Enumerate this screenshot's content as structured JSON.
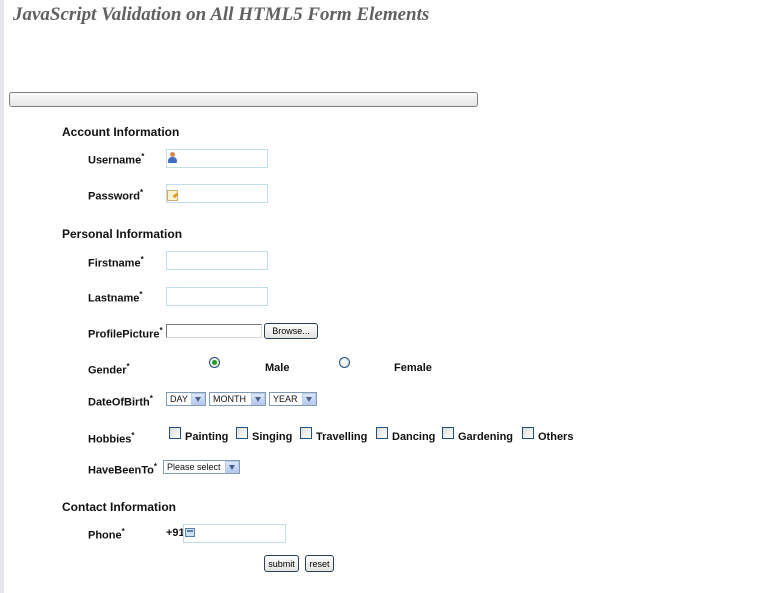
{
  "page": {
    "title": "JavaScript Validation on All HTML5 Form Elements"
  },
  "required_marker": "*",
  "account": {
    "heading": "Account Information",
    "username_label": "Username",
    "username_icon": "user-icon",
    "password_label": "Password",
    "password_icon": "key-icon"
  },
  "personal": {
    "heading": "Personal Information",
    "firstname_label": "Firstname",
    "lastname_label": "Lastname",
    "profile_picture_label": "ProfilePicture",
    "browse_label": "Browse...",
    "gender_label": "Gender",
    "gender_options": [
      {
        "label": "Male",
        "checked": true
      },
      {
        "label": "Female",
        "checked": false
      }
    ],
    "dob_label": "DateOfBirth",
    "dob_day": "DAY",
    "dob_month": "MONTH",
    "dob_year": "YEAR",
    "hobbies_label": "Hobbies",
    "hobbies": [
      {
        "label": "Painting",
        "checked": false
      },
      {
        "label": "Singing",
        "checked": false
      },
      {
        "label": "Travelling",
        "checked": false
      },
      {
        "label": "Dancing",
        "checked": false
      },
      {
        "label": "Gardening",
        "checked": false
      },
      {
        "label": "Others",
        "checked": false
      }
    ],
    "havebeento_label": "HaveBeenTo",
    "havebeento_selected": "Please select"
  },
  "contact": {
    "heading": "Contact Information",
    "phone_label": "Phone",
    "phone_prefix": "+91",
    "phone_icon": "phone-icon"
  },
  "actions": {
    "submit_label": "submit",
    "reset_label": "reset"
  },
  "colors": {
    "title": "#616161",
    "field_border": "#c3dde8",
    "radio_checked": "#21a121",
    "select_arrow": "#b4c8f2"
  }
}
